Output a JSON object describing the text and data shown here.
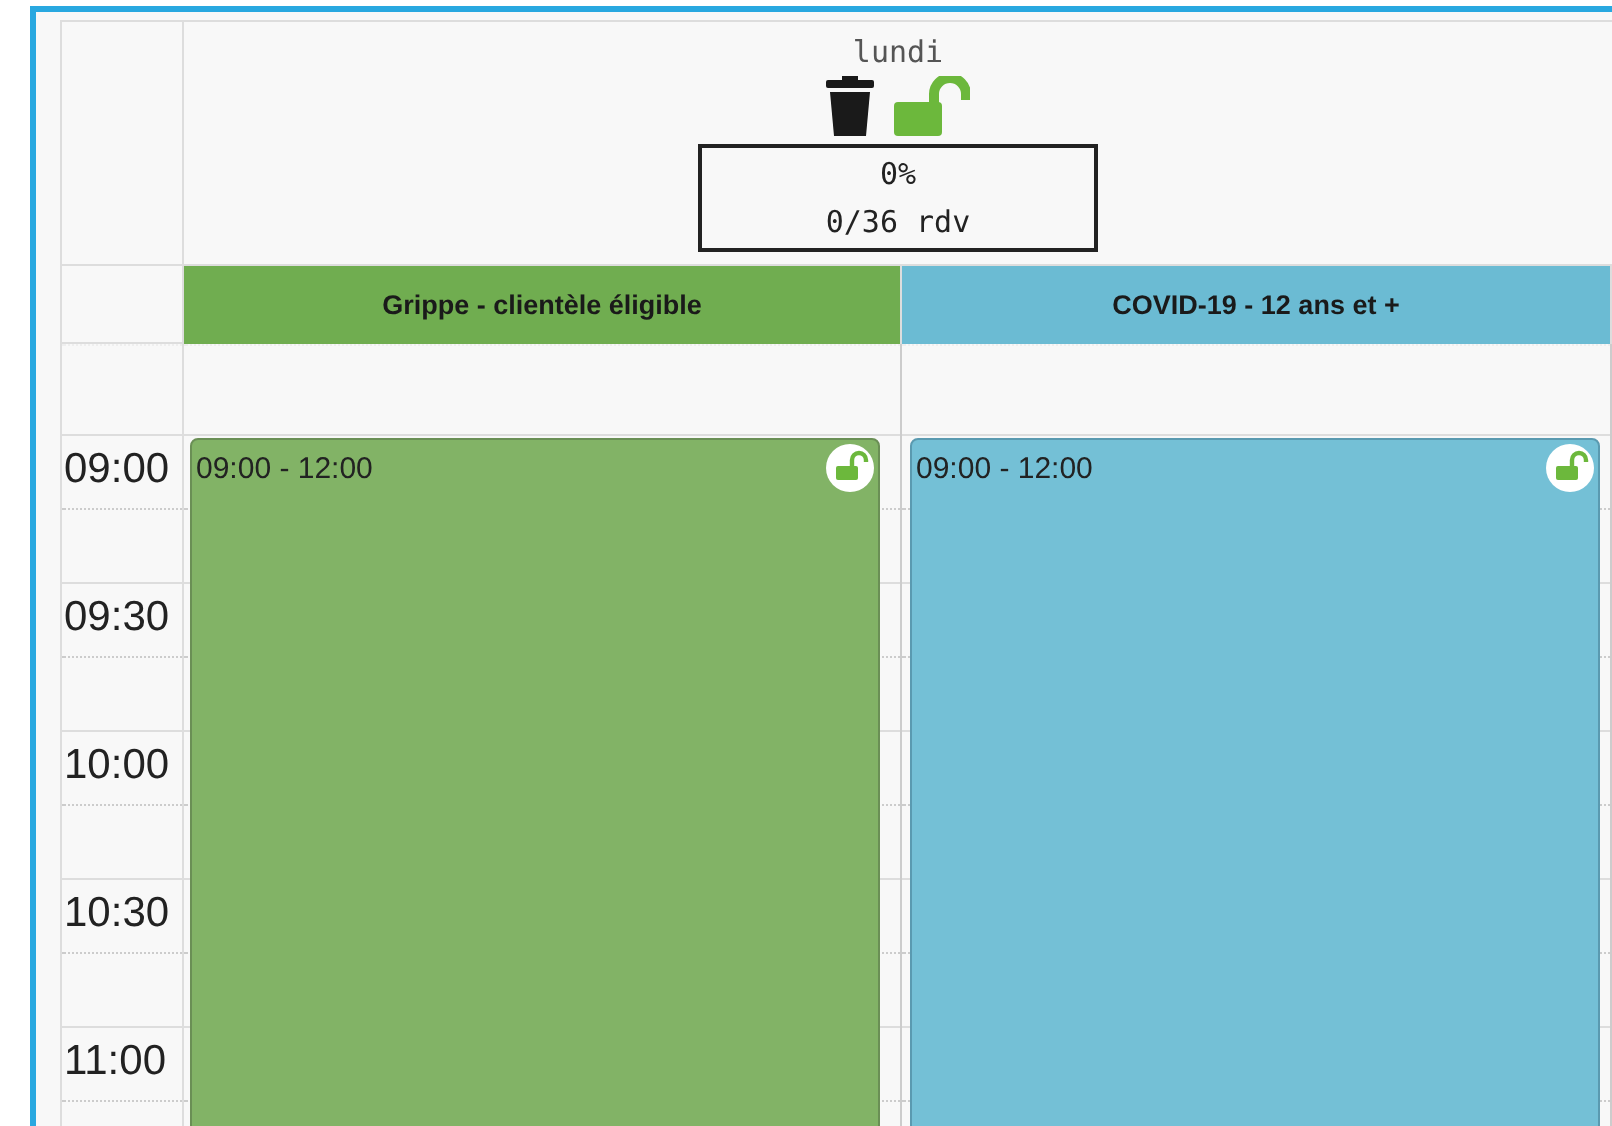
{
  "day": {
    "label": "lundi",
    "locked": false,
    "percent": "0%",
    "count": "0/36 rdv"
  },
  "columns": [
    {
      "name": "Grippe - clientèle éligible",
      "color": "#70ad50",
      "events": [
        {
          "time": "09:00 - 12:00",
          "color": "#82b366",
          "locked": false
        }
      ]
    },
    {
      "name": "COVID-19 - 12 ans et +",
      "color": "#6bbbd3",
      "events": [
        {
          "time": "09:00 - 12:00",
          "color": "#74c0d6",
          "locked": false
        }
      ]
    }
  ],
  "times": [
    "09:00",
    "09:30",
    "10:00",
    "10:30",
    "11:00"
  ]
}
